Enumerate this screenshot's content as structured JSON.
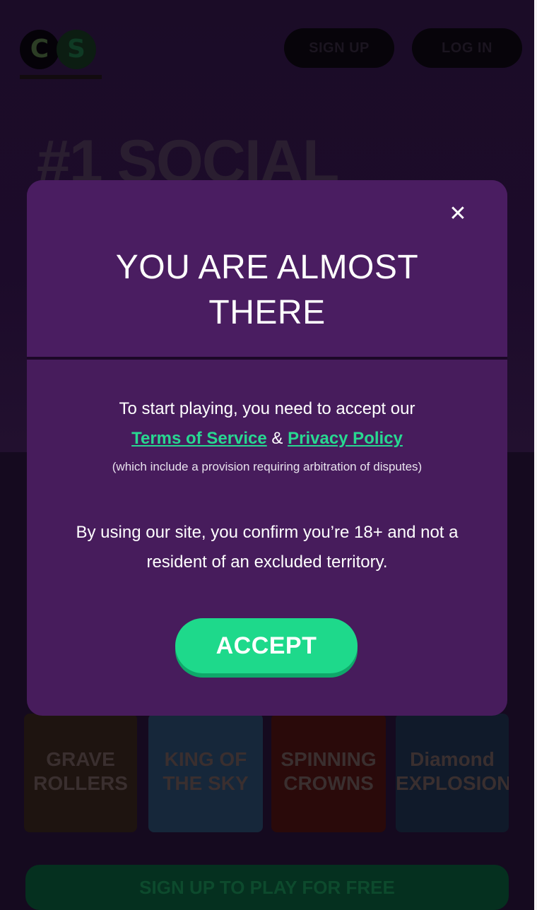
{
  "header": {
    "logo_text_left": "C",
    "logo_text_right": "S",
    "signup_label": "SIGN UP",
    "login_label": "LOG IN"
  },
  "hero": {
    "title": "#1 SOCIAL"
  },
  "games": [
    {
      "title": "GRAVE ROLLERS"
    },
    {
      "title": "KING OF THE SKY"
    },
    {
      "title": "SPINNING CROWNS"
    },
    {
      "title": "Diamond EXPLOSION"
    }
  ],
  "bottom_cta_label": "SIGN UP TO PLAY FOR FREE",
  "modal": {
    "close_glyph": "✕",
    "title": "YOU ARE ALMOST THERE",
    "intro": "To start playing, you need to accept our",
    "terms_link": "Terms of Service",
    "amp": "&",
    "privacy_link": "Privacy Policy",
    "note": "(which include a provision requiring arbitration of disputes)",
    "confirm": "By using our site, you confirm you’re 18+ and not a resident of an excluded territory.",
    "accept_label": "ACCEPT"
  },
  "colors": {
    "modal_bg": "#471c5c",
    "link": "#28d891",
    "accept_bg": "#1ed98b"
  }
}
